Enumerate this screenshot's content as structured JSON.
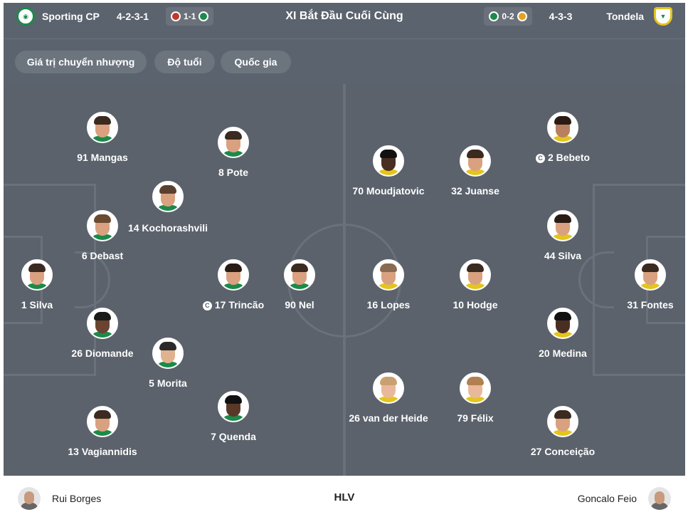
{
  "header": {
    "title": "XI Bắt Đầu Cuối Cùng",
    "home": {
      "name": "Sporting CP",
      "formation": "4-2-3-1",
      "last_score": "1-1"
    },
    "away": {
      "name": "Tondela",
      "formation": "4-3-3",
      "last_score": "0-2"
    }
  },
  "filters": [
    {
      "label": "Giá trị chuyển nhượng"
    },
    {
      "label": "Độ tuổi"
    },
    {
      "label": "Quốc gia"
    }
  ],
  "home_players": [
    {
      "label": "1 Silva",
      "captain": false
    },
    {
      "label": "6 Debast",
      "captain": false
    },
    {
      "label": "26 Diomande",
      "captain": false
    },
    {
      "label": "91 Mangas",
      "captain": false
    },
    {
      "label": "13 Vagiannidis",
      "captain": false
    },
    {
      "label": "14 Kochorashvili",
      "captain": false
    },
    {
      "label": "5 Morita",
      "captain": false
    },
    {
      "label": "8 Pote",
      "captain": false
    },
    {
      "label": "17 Trincão",
      "captain": true
    },
    {
      "label": "7 Quenda",
      "captain": false
    },
    {
      "label": "90 Nel",
      "captain": false
    }
  ],
  "away_players": [
    {
      "label": "70 Moudjatovic",
      "captain": false
    },
    {
      "label": "16 Lopes",
      "captain": false
    },
    {
      "label": "26 van der Heide",
      "captain": false
    },
    {
      "label": "32 Juanse",
      "captain": false
    },
    {
      "label": "10 Hodge",
      "captain": false
    },
    {
      "label": "79 Félix",
      "captain": false
    },
    {
      "label": "2 Bebeto",
      "captain": true
    },
    {
      "label": "44 Silva",
      "captain": false
    },
    {
      "label": "20 Medina",
      "captain": false
    },
    {
      "label": "27 Conceição",
      "captain": false
    },
    {
      "label": "31 Fontes",
      "captain": false
    }
  ],
  "footer": {
    "label": "HLV",
    "home_coach": "Rui Borges",
    "away_coach": "Goncalo Feio"
  },
  "colors": {
    "pitch": "#5b626c",
    "lines": "#6a717b",
    "sporting_green": "#1b8a4a",
    "tondela_yellow": "#e3c51e"
  }
}
